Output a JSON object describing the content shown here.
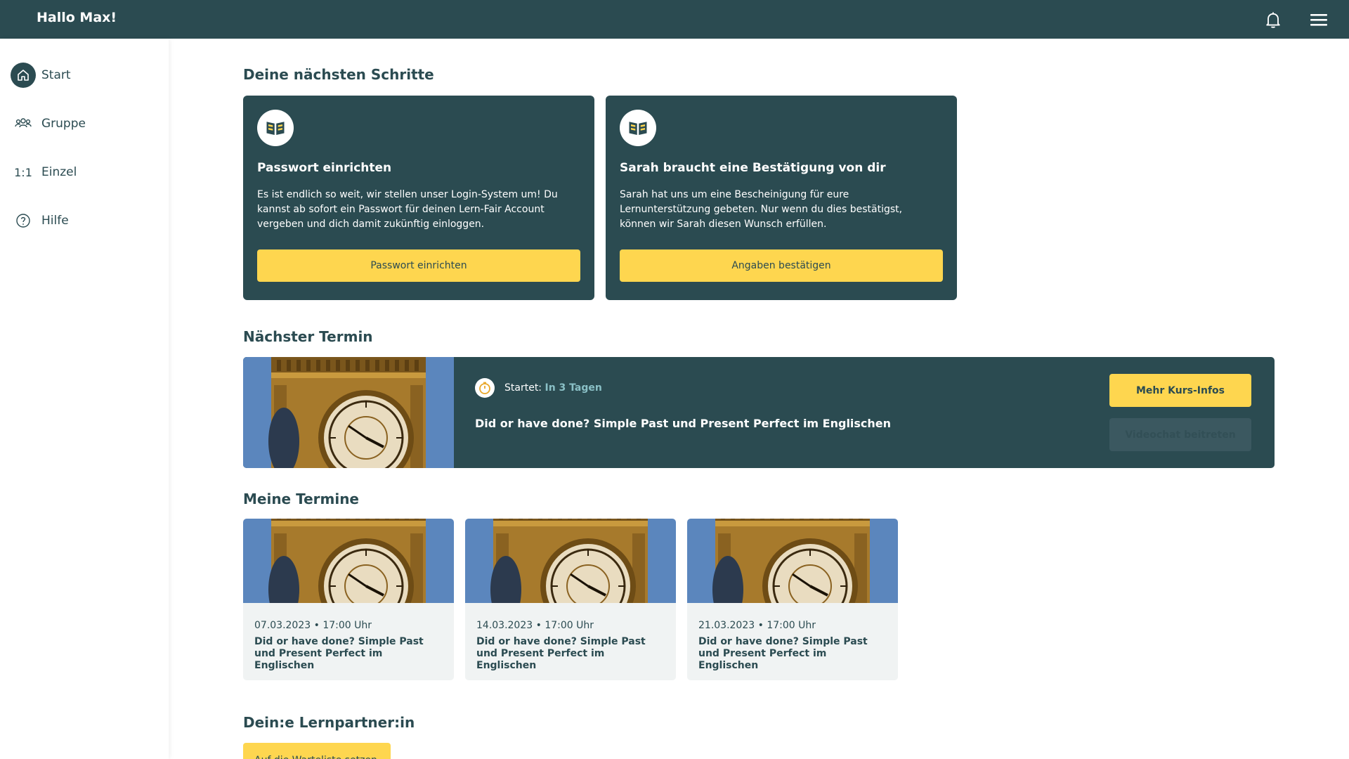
{
  "header": {
    "greeting": "Hallo Max!",
    "bell_icon": "bell-icon",
    "menu_icon": "hamburger-menu-icon"
  },
  "sidebar": {
    "items": [
      {
        "label": "Start",
        "icon": "home-icon",
        "active": true
      },
      {
        "label": "Gruppe",
        "icon": "group-icon"
      },
      {
        "label": "Einzel",
        "icon_text": "1:1"
      },
      {
        "label": "Hilfe",
        "icon": "help-icon"
      }
    ]
  },
  "sections": {
    "next_steps": "Deine nächsten Schritte",
    "next_appointment": "Nächster Termin",
    "my_appointments": "Meine Termine",
    "learning_partner": "Dein:e Lernpartner:in"
  },
  "steps": [
    {
      "title": "Passwort einrichten",
      "description": "Es ist endlich so weit, wir stellen unser Login-System um! Du kannst ab sofort ein Passwort für deinen Lern-Fair Account vergeben und dich damit zukünftig einloggen.",
      "button": "Passwort einrichten"
    },
    {
      "title": "Sarah braucht eine Bestätigung von dir",
      "description": "Sarah hat uns um eine Bescheinigung für eure Lernunterstützung gebeten. Nur wenn du dies bestätigst, können wir Sarah diesen Wunsch erfüllen.",
      "button": "Angaben bestätigen"
    }
  ],
  "next_course": {
    "starts_label": "Startet:",
    "starts_when": "In 3 Tagen",
    "title": "Did or have done? Simple Past und Present Perfect im Englischen",
    "more_info_button": "Mehr Kurs-Infos",
    "video_button": "Videochat beitreten"
  },
  "appointments": [
    {
      "date": "07.03.2023 • 17:00 Uhr",
      "title": "Did or have done? Simple Past und Present Perfect im Englischen"
    },
    {
      "date": "14.03.2023 • 17:00 Uhr",
      "title": "Did or have done? Simple Past und Present Perfect im Englischen"
    },
    {
      "date": "21.03.2023 • 17:00 Uhr",
      "title": "Did or have done? Simple Past und Present Perfect im Englischen"
    }
  ],
  "waitlist_button": "Auf die Warteliste setzen",
  "colors": {
    "primary": "#2b4b51",
    "accent": "#fed64f",
    "highlight": "#8ac0c6"
  }
}
